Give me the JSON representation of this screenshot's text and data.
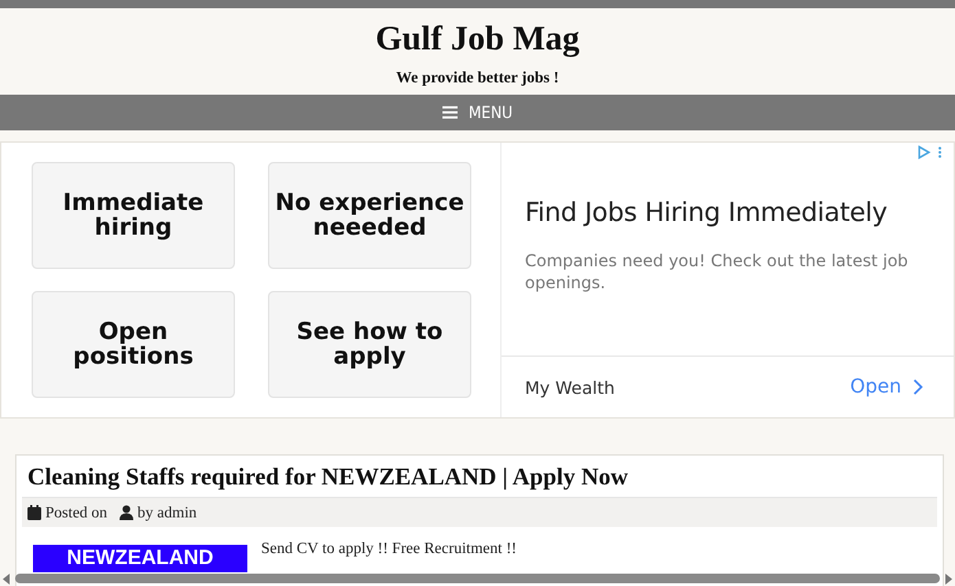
{
  "site": {
    "title": "Gulf Job Mag",
    "tagline": "We provide better jobs !"
  },
  "menu": {
    "label": "MENU"
  },
  "ad": {
    "tiles": [
      "Immediate hiring",
      "No experience neeeded",
      "Open positions",
      "See how to apply"
    ],
    "headline": "Find Jobs Hiring Immediately",
    "body": "Companies need you! Check out the latest job openings.",
    "advertiser": "My Wealth",
    "action": "Open"
  },
  "post": {
    "title": "Cleaning Staffs required for NEWZEALAND | Apply Now",
    "posted": "Posted on",
    "author": "by admin",
    "banner": "NEWZEALAND",
    "excerpt": "Send CV to apply !! Free Recruitment !!"
  }
}
